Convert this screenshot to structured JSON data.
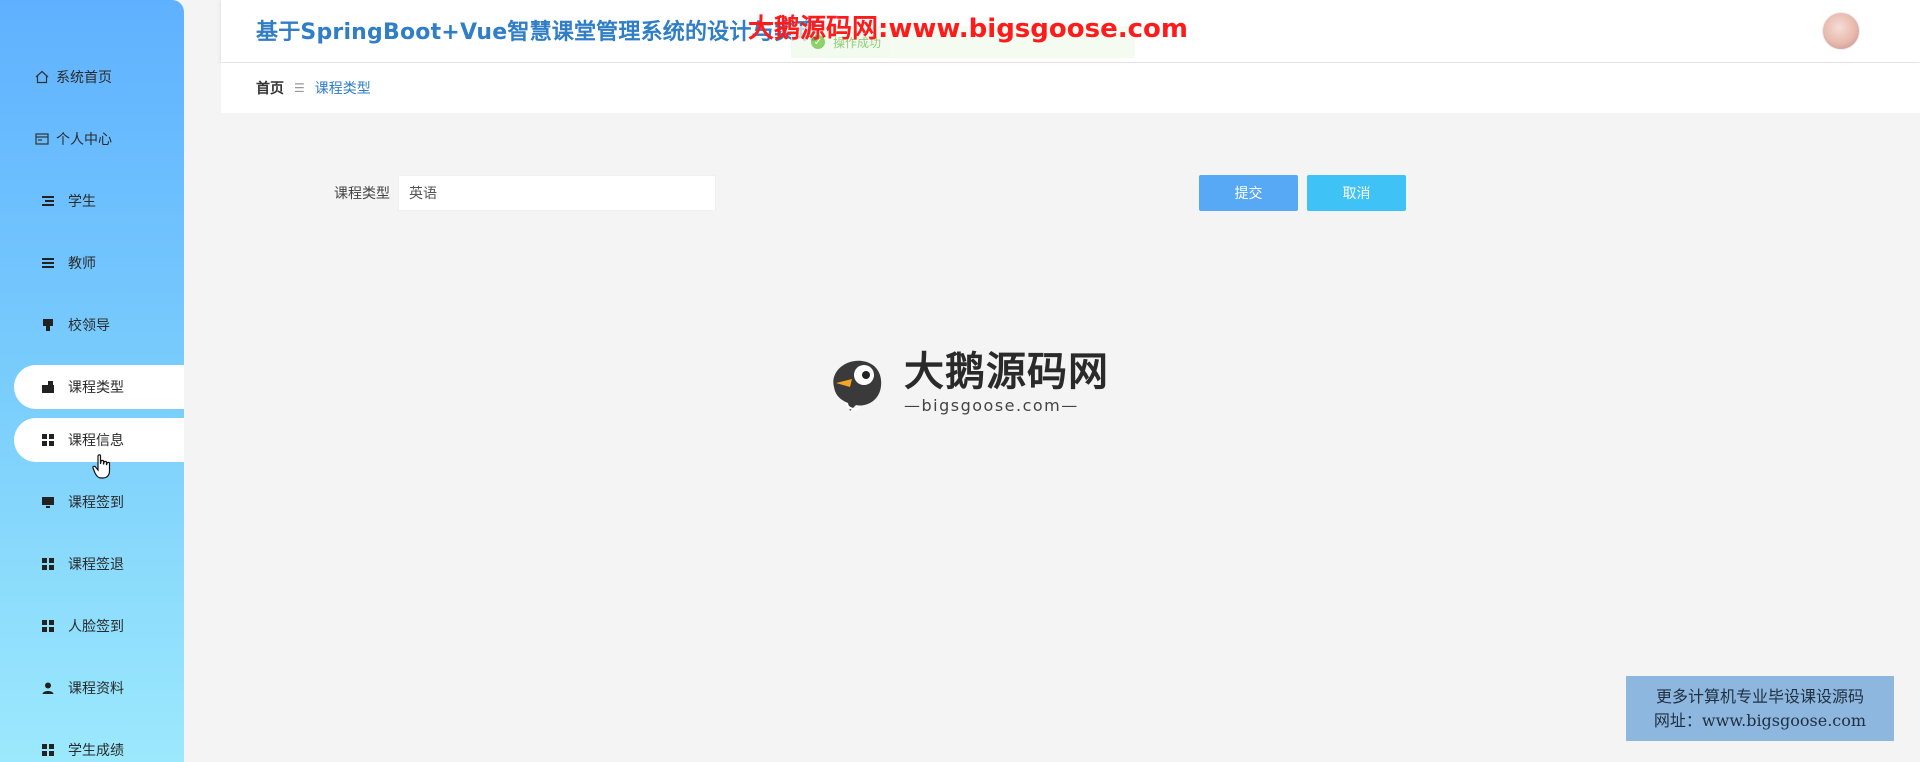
{
  "header": {
    "title": "基于SpringBoot+Vue智慧课堂管理系统的设计与实现",
    "watermark": "大鹅源码网:www.bigsgoose.com",
    "toast": "操作成功"
  },
  "sidebar": {
    "items": [
      {
        "label": "系统首页",
        "icon": "home-icon"
      },
      {
        "label": "个人中心",
        "icon": "profile-icon"
      },
      {
        "label": "学生",
        "icon": "list-icon"
      },
      {
        "label": "教师",
        "icon": "menu-icon"
      },
      {
        "label": "校领导",
        "icon": "badge-icon"
      },
      {
        "label": "课程类型",
        "icon": "briefcase-icon",
        "active": true
      },
      {
        "label": "课程信息",
        "icon": "grid-icon",
        "active": true
      },
      {
        "label": "课程签到",
        "icon": "monitor-icon"
      },
      {
        "label": "课程签退",
        "icon": "grid-icon"
      },
      {
        "label": "人脸签到",
        "icon": "grid-icon"
      },
      {
        "label": "课程资料",
        "icon": "user-icon"
      },
      {
        "label": "学生成绩",
        "icon": "grid-icon"
      }
    ]
  },
  "breadcrumb": {
    "home": "首页",
    "separator": "☰",
    "current": "课程类型"
  },
  "form": {
    "label": "课程类型",
    "value": "英语"
  },
  "buttons": {
    "submit": "提交",
    "cancel": "取消"
  },
  "logo": {
    "main": "大鹅源码网",
    "sub": "—bigsgoose.com—"
  },
  "adbox": {
    "line1": "更多计算机专业毕设课设源码",
    "line2": "网址：www.bigsgoose.com"
  },
  "colors": {
    "accent": "#2f7ec6",
    "submit": "#57a9f5",
    "cancel": "#3fc2f6",
    "watermark": "#ff1b1b"
  }
}
